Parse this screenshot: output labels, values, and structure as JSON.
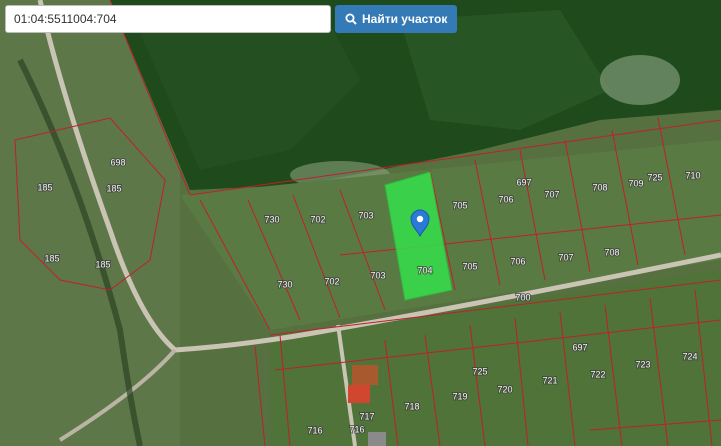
{
  "search": {
    "value": "01:04:5511004:704",
    "button_label": "Найти участок",
    "button_icon": "search-icon"
  },
  "colors": {
    "boundary": "#c0202a",
    "selected_fill": "#35e04a",
    "button": "#337ab7",
    "marker": "#2a7ad6"
  },
  "selected_plot": {
    "number": "704",
    "marker_icon": "map-marker-icon"
  },
  "plot_labels": [
    "698",
    "185",
    "185",
    "185",
    "185",
    "730",
    "702",
    "703",
    "705",
    "706",
    "697",
    "707",
    "708",
    "709",
    "725",
    "710",
    "730",
    "702",
    "703",
    "704",
    "705",
    "706",
    "707",
    "708",
    "700",
    "697",
    "725",
    "722",
    "723",
    "724",
    "720",
    "721",
    "719",
    "718",
    "717",
    "716",
    "716"
  ]
}
